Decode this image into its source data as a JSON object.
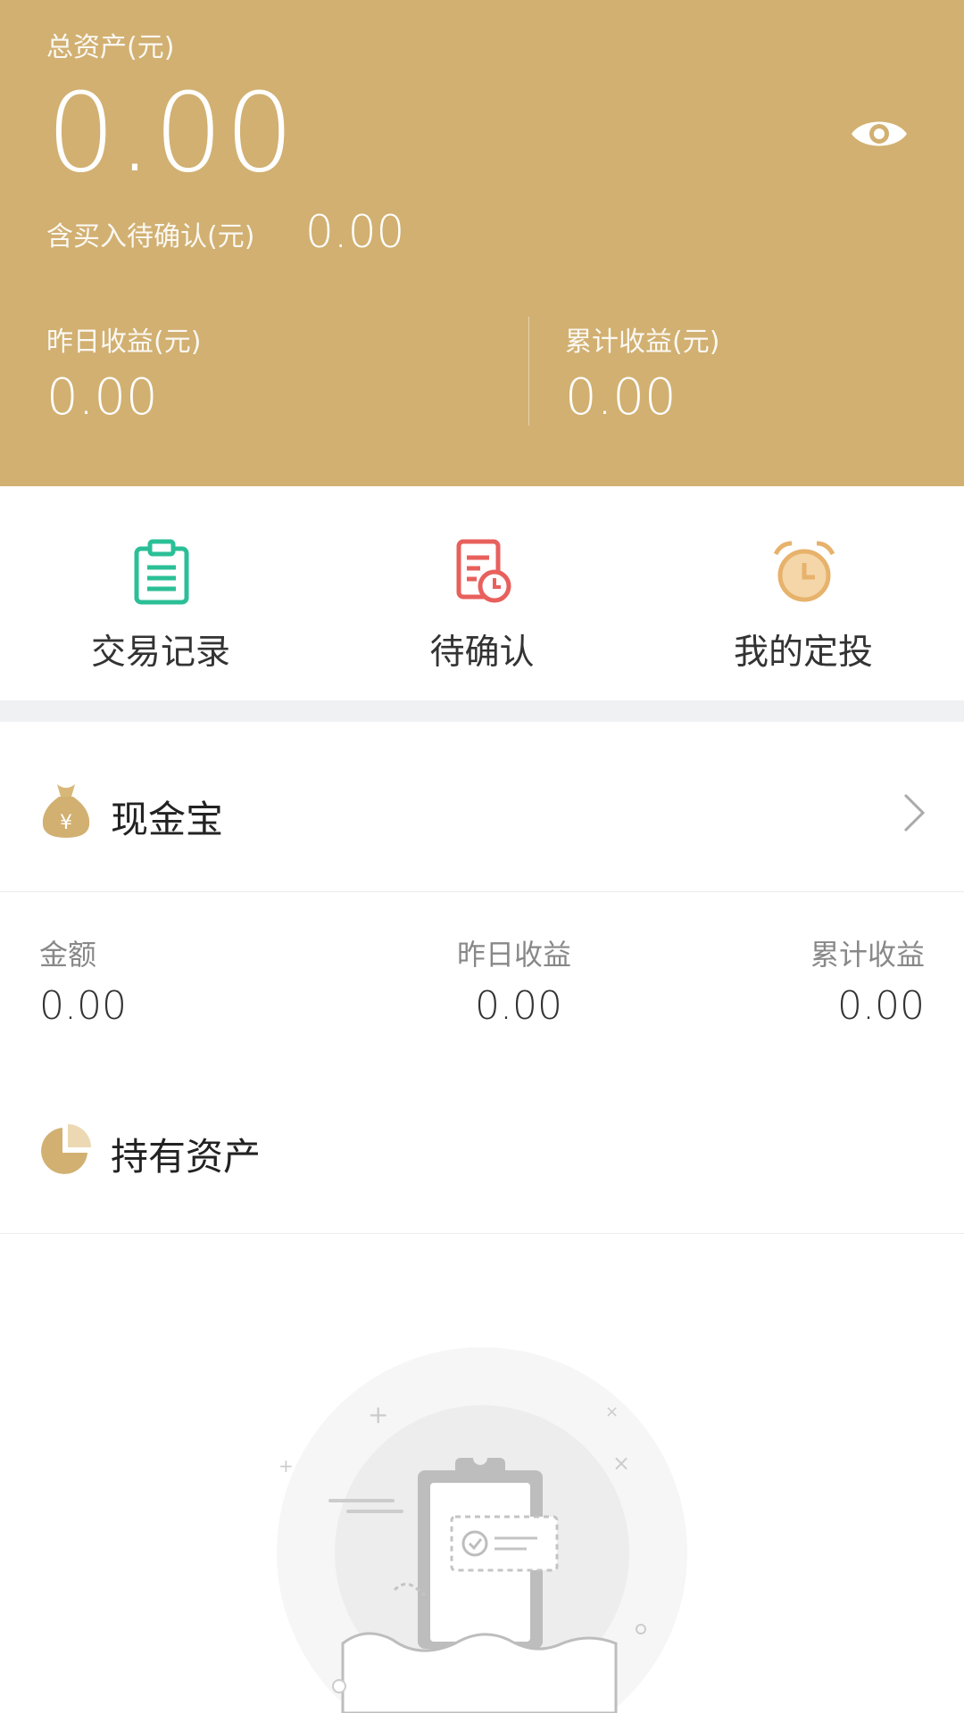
{
  "header": {
    "total_label": "总资产(元)",
    "total_value": "0.00",
    "pending_label": "含买入待确认(元)",
    "pending_value": "0.00",
    "yesterday_label": "昨日收益(元)",
    "yesterday_value": "0.00",
    "cumulative_label": "累计收益(元)",
    "cumulative_value": "0.00",
    "eye_icon": "eye-icon",
    "bg_color": "#d1b071"
  },
  "quick_actions": [
    {
      "label": "交易记录",
      "icon": "clipboard-icon",
      "color": "#2bbf97"
    },
    {
      "label": "待确认",
      "icon": "document-clock-icon",
      "color": "#e8605c"
    },
    {
      "label": "我的定投",
      "icon": "alarm-clock-icon",
      "color": "#e7b26b"
    }
  ],
  "cash": {
    "title": "现金宝",
    "icon": "money-bag-icon",
    "amount_label": "金额",
    "amount_value": "0.00",
    "yesterday_label": "昨日收益",
    "yesterday_value": "0.00",
    "cumulative_label": "累计收益",
    "cumulative_value": "0.00"
  },
  "holdings": {
    "title": "持有资产",
    "icon": "pie-chart-icon",
    "empty_illustration": "empty-state-illustration"
  }
}
